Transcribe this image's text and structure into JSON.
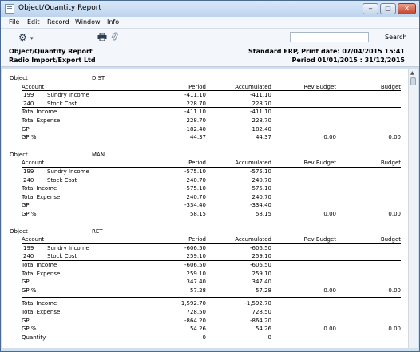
{
  "window": {
    "title": "Object/Quantity Report"
  },
  "titlebar": {
    "minimize": "‒",
    "maximize": "□",
    "close": "✕"
  },
  "menu": [
    "File",
    "Edit",
    "Record",
    "Window",
    "Info"
  ],
  "toolbar": {
    "search_button": "Search",
    "search_value": ""
  },
  "header": {
    "left_title": "Object/Quantity Report",
    "company": "Radio Import/Export Ltd",
    "right_title": "Standard ERP, Print date: 07/04/2015 15:41",
    "period": "Period  01/01/2015 : 31/12/2015"
  },
  "columns": {
    "account": "Account",
    "period": "Period",
    "accumulated": "Accumulated",
    "rev_budget": "Rev Budget",
    "budget": "Budget"
  },
  "groups": [
    {
      "object_label": "Object",
      "object_code": "DIST",
      "accounts": [
        {
          "code": "199",
          "name": "Sundry Income",
          "period": "-411.10",
          "accumulated": "-411.10"
        },
        {
          "code": "240",
          "name": "Stock Cost",
          "period": "228.70",
          "accumulated": "228.70"
        }
      ],
      "totals": [
        {
          "label": "Total Income",
          "period": "-411.10",
          "accumulated": "-411.10",
          "rev_budget": "",
          "budget": ""
        },
        {
          "label": "Total Expense",
          "period": "228.70",
          "accumulated": "228.70",
          "rev_budget": "",
          "budget": ""
        },
        {
          "label": "GP",
          "period": "-182.40",
          "accumulated": "-182.40",
          "rev_budget": "",
          "budget": ""
        },
        {
          "label": "GP %",
          "period": "44.37",
          "accumulated": "44.37",
          "rev_budget": "0.00",
          "budget": "0.00"
        }
      ]
    },
    {
      "object_label": "Object",
      "object_code": "MAN",
      "accounts": [
        {
          "code": "199",
          "name": "Sundry Income",
          "period": "-575.10",
          "accumulated": "-575.10"
        },
        {
          "code": "240",
          "name": "Stock Cost",
          "period": "240.70",
          "accumulated": "240.70"
        }
      ],
      "totals": [
        {
          "label": "Total Income",
          "period": "-575.10",
          "accumulated": "-575.10",
          "rev_budget": "",
          "budget": ""
        },
        {
          "label": "Total Expense",
          "period": "240.70",
          "accumulated": "240.70",
          "rev_budget": "",
          "budget": ""
        },
        {
          "label": "GP",
          "period": "-334.40",
          "accumulated": "-334.40",
          "rev_budget": "",
          "budget": ""
        },
        {
          "label": "GP %",
          "period": "58.15",
          "accumulated": "58.15",
          "rev_budget": "0.00",
          "budget": "0.00"
        }
      ]
    },
    {
      "object_label": "Object",
      "object_code": "RET",
      "accounts": [
        {
          "code": "199",
          "name": "Sundry Income",
          "period": "-606.50",
          "accumulated": "-606.50"
        },
        {
          "code": "240",
          "name": "Stock Cost",
          "period": "259.10",
          "accumulated": "259.10"
        }
      ],
      "totals": [
        {
          "label": "Total Income",
          "period": "-606.50",
          "accumulated": "-606.50",
          "rev_budget": "",
          "budget": ""
        },
        {
          "label": "Total Expense",
          "period": "259.10",
          "accumulated": "259.10",
          "rev_budget": "",
          "budget": ""
        },
        {
          "label": "GP",
          "period": "347.40",
          "accumulated": "347.40",
          "rev_budget": "",
          "budget": ""
        },
        {
          "label": "GP %",
          "period": "57.28",
          "accumulated": "57.28",
          "rev_budget": "0.00",
          "budget": "0.00"
        }
      ]
    }
  ],
  "grand_totals": [
    {
      "label": "Total Income",
      "period": "-1,592.70",
      "accumulated": "-1,592.70",
      "rev_budget": "",
      "budget": ""
    },
    {
      "label": "Total Expense",
      "period": "728.50",
      "accumulated": "728.50",
      "rev_budget": "",
      "budget": ""
    },
    {
      "label": "GP",
      "period": "-864.20",
      "accumulated": "-864.20",
      "rev_budget": "",
      "budget": ""
    },
    {
      "label": "GP %",
      "period": "54.26",
      "accumulated": "54.26",
      "rev_budget": "0.00",
      "budget": "0.00"
    },
    {
      "label": "Quantity",
      "period": "0",
      "accumulated": "0",
      "rev_budget": "",
      "budget": ""
    }
  ],
  "icons": {
    "app": "report-window-icon",
    "settings": "gear-icon",
    "print": "printer-icon",
    "attach": "paperclip-icon"
  }
}
